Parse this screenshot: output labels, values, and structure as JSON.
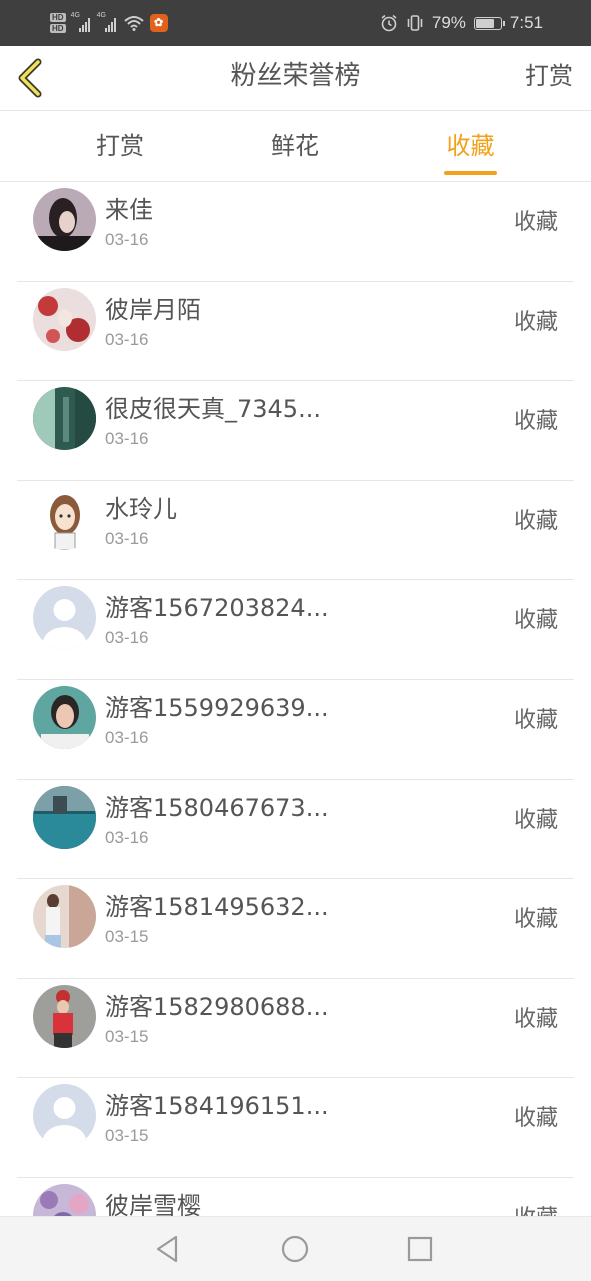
{
  "status_bar": {
    "hd_1": "HD",
    "hd_2": "HD",
    "network_1": "4G",
    "network_2": "4G",
    "battery_percent": "79%",
    "battery_level": 0.79,
    "time": "7:51"
  },
  "header": {
    "title": "粉丝荣誉榜",
    "action_label": "打赏"
  },
  "tabs": [
    {
      "label": "打赏",
      "active": false
    },
    {
      "label": "鲜花",
      "active": false
    },
    {
      "label": "收藏",
      "active": true
    }
  ],
  "colors": {
    "accent": "#f0a21a",
    "status_bar": "#3f3f3f",
    "text_primary": "#555555",
    "text_secondary": "#9a9a9a",
    "divider": "#e6e6e6"
  },
  "fans": [
    {
      "name": "来佳",
      "date": "03-16",
      "action": "收藏",
      "avatar": "user-photo-avatar"
    },
    {
      "name": "彼岸月陌",
      "date": "03-16",
      "action": "收藏",
      "avatar": "user-photo-avatar"
    },
    {
      "name": "很皮很天真_7345...",
      "date": "03-16",
      "action": "收藏",
      "avatar": "user-photo-avatar"
    },
    {
      "name": "水玲儿",
      "date": "03-16",
      "action": "收藏",
      "avatar": "cartoon-avatar"
    },
    {
      "name": "游客1567203824...",
      "date": "03-16",
      "action": "收藏",
      "avatar": "default-avatar"
    },
    {
      "name": "游客1559929639...",
      "date": "03-16",
      "action": "收藏",
      "avatar": "user-photo-avatar"
    },
    {
      "name": "游客1580467673...",
      "date": "03-16",
      "action": "收藏",
      "avatar": "user-photo-avatar"
    },
    {
      "name": "游客1581495632...",
      "date": "03-15",
      "action": "收藏",
      "avatar": "user-photo-avatar"
    },
    {
      "name": "游客1582980688...",
      "date": "03-15",
      "action": "收藏",
      "avatar": "user-photo-avatar"
    },
    {
      "name": "游客1584196151...",
      "date": "03-15",
      "action": "收藏",
      "avatar": "default-avatar"
    },
    {
      "name": "彼岸雪樱",
      "date": "",
      "action": "收藏",
      "avatar": "user-photo-avatar"
    }
  ],
  "nav_bar": {
    "back": "back-triangle-icon",
    "home": "home-circle-icon",
    "recents": "recents-square-icon"
  }
}
